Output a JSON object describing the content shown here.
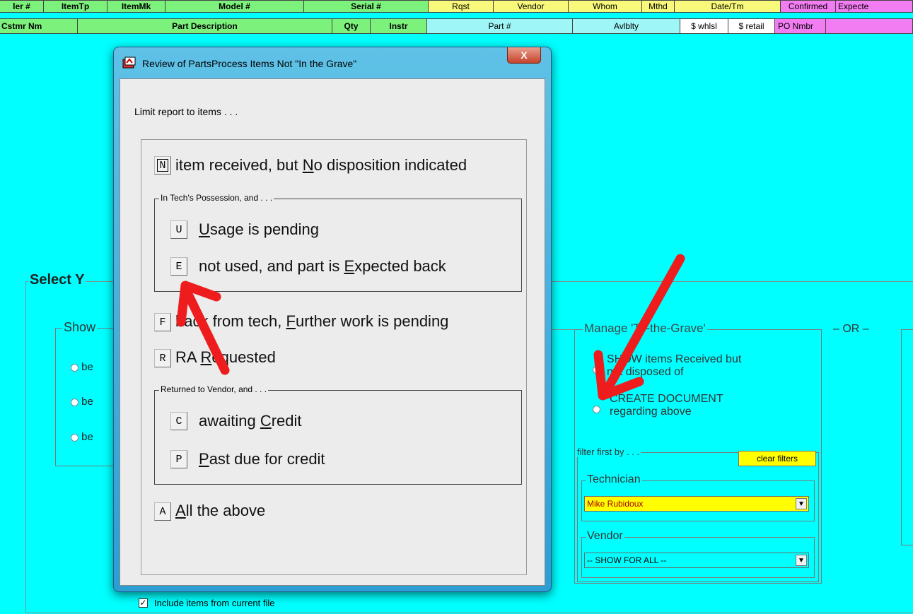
{
  "header_row1": [
    "ler #",
    "ItemTp",
    "ItemMk",
    "Model #",
    "Serial #",
    "Rqst",
    "Vendor",
    "Whom",
    "Mthd",
    "Date/Tm",
    "Confirmed",
    "Expecte"
  ],
  "header_row2": [
    "Cstmr Nm",
    "Part Description",
    "Qty",
    "Instr",
    "Part #",
    "Avlblty",
    "$ whlsl",
    "$ retail",
    "PO Nmbr",
    ""
  ],
  "main": {
    "select_legend": "Select Y",
    "show_legend": "Show",
    "radio_labels": [
      "be",
      "be",
      "be"
    ],
    "manage": {
      "legend": "Manage 'To-the-Grave'",
      "show_received_line1": "SHOW items Received but",
      "show_received_line2": "not disposed of",
      "create_doc_line1": "CREATE DOCUMENT",
      "create_doc_line2": "regarding above",
      "or_label": "– OR –",
      "filter_legend": "filter first by . . .",
      "clear_filters": "clear filters",
      "technician_legend": "Technician",
      "technician_value": "Mike Rubidoux",
      "vendor_legend": "Vendor",
      "vendor_value": "-- SHOW FOR ALL --"
    }
  },
  "dialog": {
    "title": "Review of PartsProcess Items Not \"In the Grave\"",
    "close_glyph": "X",
    "limit_label": "Limit report to items . . .",
    "in_tech_legend": "In Tech's Possession, and . . .",
    "returned_legend": "Returned to Vendor, and . . .",
    "options": {
      "n": {
        "key": "N",
        "pre": "item received, but ",
        "ul": "N",
        "post": "o disposition indicated"
      },
      "u": {
        "key": "U",
        "pre": "",
        "ul": "U",
        "post": "sage is pending"
      },
      "e": {
        "key": "E",
        "pre": "not used, and part is ",
        "ul": "E",
        "post": "xpected back"
      },
      "f": {
        "key": "F",
        "pre": "back from tech, ",
        "ul": "F",
        "post": "urther work is pending"
      },
      "r": {
        "key": "R",
        "pre": "RA ",
        "ul": "R",
        "post": "equested"
      },
      "c": {
        "key": "C",
        "pre": "awaiting ",
        "ul": "C",
        "post": "redit"
      },
      "p": {
        "key": "P",
        "pre": "",
        "ul": "P",
        "post": "ast due for credit"
      },
      "a": {
        "key": "A",
        "pre": "",
        "ul": "A",
        "post": "ll the above"
      }
    },
    "include_checkbox_label": "Include items from current file",
    "include_checked": true,
    "check_glyph": "✓"
  }
}
